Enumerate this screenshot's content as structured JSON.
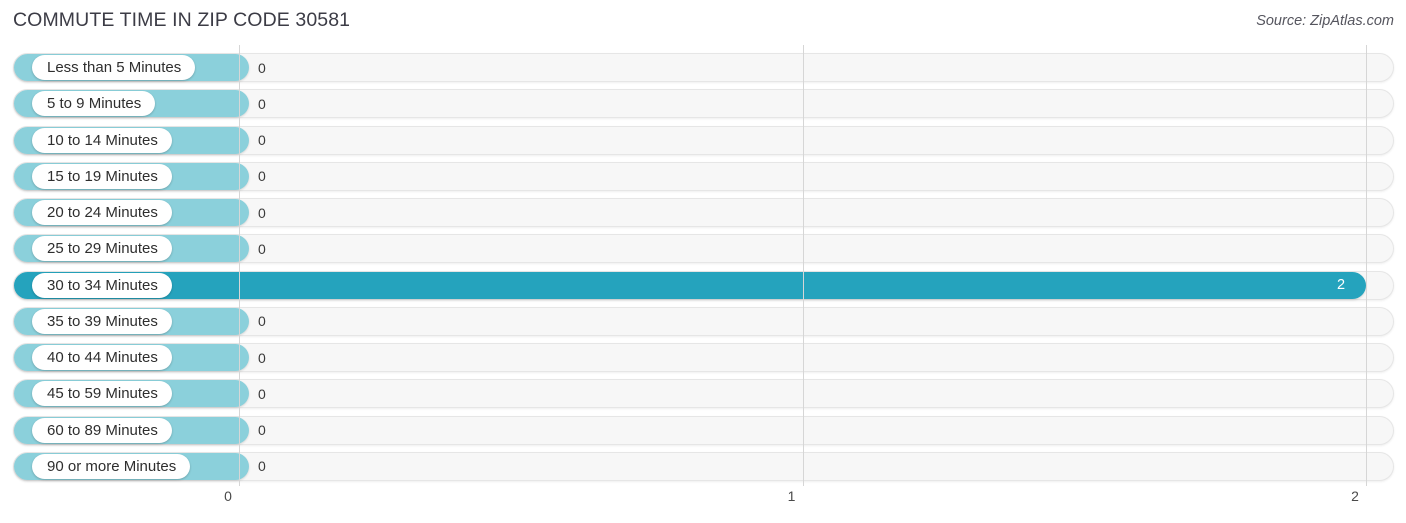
{
  "header": {
    "title": "COMMUTE TIME IN ZIP CODE 30581",
    "source": "Source: ZipAtlas.com"
  },
  "colors": {
    "bar": "#8bd0db",
    "bar_highlight": "#25a3bd",
    "track": "#f7f7f7",
    "gridline": "#d6d6d6",
    "title": "#3c3c46"
  },
  "chart_data": {
    "type": "bar",
    "orientation": "horizontal",
    "title": "COMMUTE TIME IN ZIP CODE 30581",
    "xlabel": "",
    "ylabel": "",
    "xlim": [
      0,
      2
    ],
    "grid": true,
    "legend": null,
    "xticks": [
      "0",
      "1",
      "2"
    ],
    "xtick_values": [
      0,
      1,
      2
    ],
    "categories": [
      "Less than 5 Minutes",
      "5 to 9 Minutes",
      "10 to 14 Minutes",
      "15 to 19 Minutes",
      "20 to 24 Minutes",
      "25 to 29 Minutes",
      "30 to 34 Minutes",
      "35 to 39 Minutes",
      "40 to 44 Minutes",
      "45 to 59 Minutes",
      "60 to 89 Minutes",
      "90 or more Minutes"
    ],
    "values": [
      0,
      0,
      0,
      0,
      0,
      0,
      2,
      0,
      0,
      0,
      0,
      0
    ],
    "value_labels": [
      "0",
      "0",
      "0",
      "0",
      "0",
      "0",
      "2",
      "0",
      "0",
      "0",
      "0",
      "0"
    ],
    "highlight_index": 6
  },
  "rows": [
    {
      "label": "Less than 5 Minutes",
      "value": 0,
      "value_label": "0"
    },
    {
      "label": "5 to 9 Minutes",
      "value": 0,
      "value_label": "0"
    },
    {
      "label": "10 to 14 Minutes",
      "value": 0,
      "value_label": "0"
    },
    {
      "label": "15 to 19 Minutes",
      "value": 0,
      "value_label": "0"
    },
    {
      "label": "20 to 24 Minutes",
      "value": 0,
      "value_label": "0"
    },
    {
      "label": "25 to 29 Minutes",
      "value": 0,
      "value_label": "0"
    },
    {
      "label": "30 to 34 Minutes",
      "value": 2,
      "value_label": "2"
    },
    {
      "label": "35 to 39 Minutes",
      "value": 0,
      "value_label": "0"
    },
    {
      "label": "40 to 44 Minutes",
      "value": 0,
      "value_label": "0"
    },
    {
      "label": "45 to 59 Minutes",
      "value": 0,
      "value_label": "0"
    },
    {
      "label": "60 to 89 Minutes",
      "value": 0,
      "value_label": "0"
    },
    {
      "label": "90 or more Minutes",
      "value": 0,
      "value_label": "0"
    }
  ],
  "axis": {
    "ticks": [
      "0",
      "1",
      "2"
    ]
  }
}
